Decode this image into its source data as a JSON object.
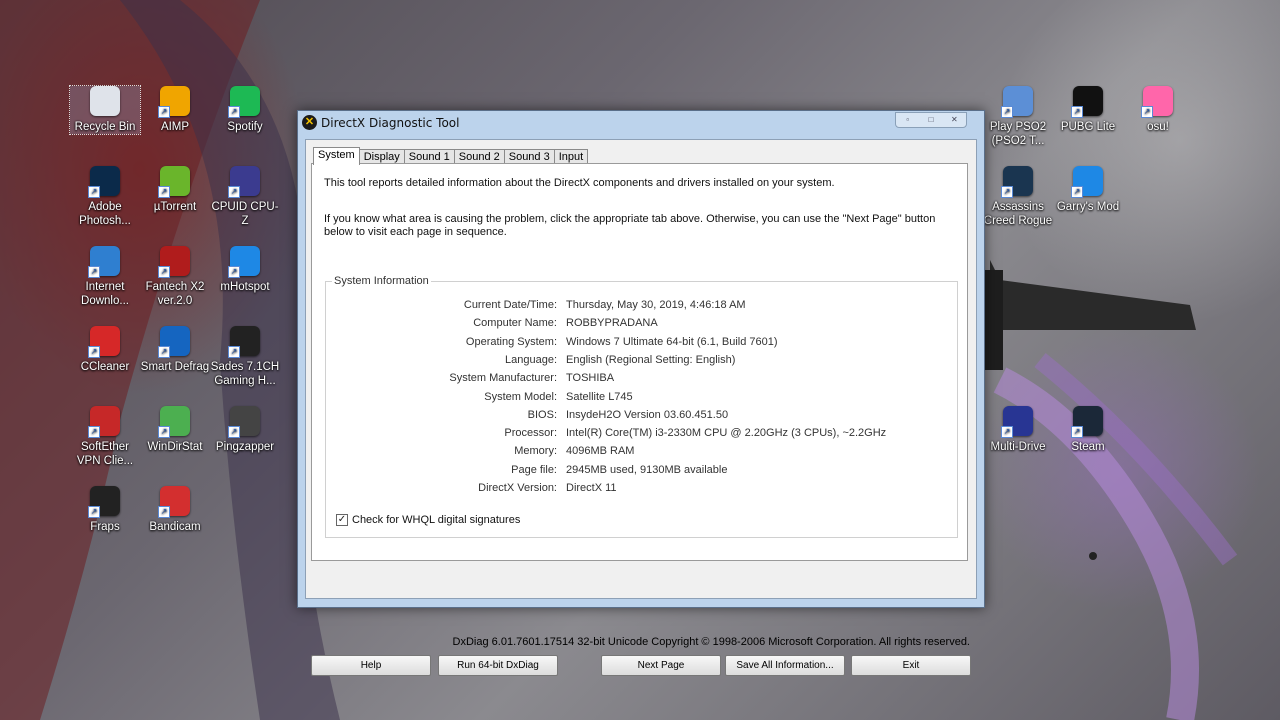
{
  "desktop": {
    "icons": [
      {
        "label": "Recycle Bin",
        "icon": "recycle-bin-icon",
        "color": "#dfe3ea"
      },
      {
        "label": "AIMP",
        "icon": "aimp-icon",
        "color": "#f0a500"
      },
      {
        "label": "Spotify",
        "icon": "spotify-icon",
        "color": "#1db954"
      },
      {
        "label": "Adobe Photosh...",
        "icon": "photoshop-icon",
        "color": "#0b2a4a"
      },
      {
        "label": "µTorrent",
        "icon": "utorrent-icon",
        "color": "#6ab52b"
      },
      {
        "label": "CPUID CPU-Z",
        "icon": "cpuz-icon",
        "color": "#3b3b8f"
      },
      {
        "label": "Internet Downlo...",
        "icon": "idm-icon",
        "color": "#2f7fd0"
      },
      {
        "label": "Fantech X2 ver.2.0",
        "icon": "fantech-icon",
        "color": "#b01c1c"
      },
      {
        "label": "mHotspot",
        "icon": "wifi-icon",
        "color": "#1e88e5"
      },
      {
        "label": "CCleaner",
        "icon": "ccleaner-icon",
        "color": "#d62828"
      },
      {
        "label": "Smart Defrag",
        "icon": "defrag-icon",
        "color": "#1565c0"
      },
      {
        "label": "Sades 7.1CH Gaming H...",
        "icon": "headset-icon",
        "color": "#222222"
      },
      {
        "label": "SoftEther VPN Clie...",
        "icon": "vpn-icon",
        "color": "#c62828"
      },
      {
        "label": "WinDirStat",
        "icon": "windirstat-icon",
        "color": "#4caf50"
      },
      {
        "label": "Pingzapper",
        "icon": "pingzapper-icon",
        "color": "#444444"
      },
      {
        "label": "Fraps",
        "icon": "fraps-icon",
        "color": "#222222"
      },
      {
        "label": "Bandicam",
        "icon": "bandicam-icon",
        "color": "#d32f2f"
      },
      {
        "label": "Play PSO2 (PSO2 T...",
        "icon": "pso2-icon",
        "color": "#5c8fd6"
      },
      {
        "label": "PUBG Lite",
        "icon": "pubg-icon",
        "color": "#111111"
      },
      {
        "label": "osu!",
        "icon": "osu-icon",
        "color": "#ff66aa"
      },
      {
        "label": "Assassins Creed Rogue",
        "icon": "acr-icon",
        "color": "#1a3550"
      },
      {
        "label": "Garry's Mod",
        "icon": "gmod-icon",
        "color": "#1e88e5"
      },
      {
        "label": "Multi-Drive",
        "icon": "multidrive-icon",
        "color": "#283593"
      },
      {
        "label": "Steam",
        "icon": "steam-icon",
        "color": "#1b2838"
      }
    ]
  },
  "window": {
    "title": "DirectX Diagnostic Tool",
    "tabs": [
      "System",
      "Display",
      "Sound 1",
      "Sound 2",
      "Sound 3",
      "Input"
    ],
    "intro1": "This tool reports detailed information about the DirectX components and drivers installed on your system.",
    "intro2": "If you know what area is causing the problem, click the appropriate tab above.  Otherwise, you can use the \"Next Page\" button below to visit each page in sequence.",
    "group_title": "System Information",
    "info": [
      {
        "label": "Current Date/Time:",
        "value": "Thursday, May 30, 2019, 4:46:18 AM"
      },
      {
        "label": "Computer Name:",
        "value": "ROBBYPRADANA"
      },
      {
        "label": "Operating System:",
        "value": "Windows 7 Ultimate 64-bit (6.1, Build 7601)"
      },
      {
        "label": "Language:",
        "value": "English (Regional Setting: English)"
      },
      {
        "label": "System Manufacturer:",
        "value": "TOSHIBA"
      },
      {
        "label": "System Model:",
        "value": "Satellite L745"
      },
      {
        "label": "BIOS:",
        "value": "InsydeH2O Version 03.60.451.50"
      },
      {
        "label": "Processor:",
        "value": "Intel(R) Core(TM) i3-2330M CPU @ 2.20GHz (3 CPUs), ~2.2GHz"
      },
      {
        "label": "Memory:",
        "value": "4096MB RAM"
      },
      {
        "label": "Page file:",
        "value": "2945MB used, 9130MB available"
      },
      {
        "label": "DirectX Version:",
        "value": "DirectX 11"
      }
    ],
    "whql_label": "Check for WHQL digital signatures",
    "whql_checked": true,
    "footer": "DxDiag 6.01.7601.17514 32-bit Unicode  Copyright © 1998-2006 Microsoft Corporation.  All rights reserved.",
    "buttons": {
      "help": "Help",
      "run64": "Run 64-bit DxDiag",
      "next": "Next Page",
      "save": "Save All Information...",
      "exit": "Exit"
    }
  }
}
